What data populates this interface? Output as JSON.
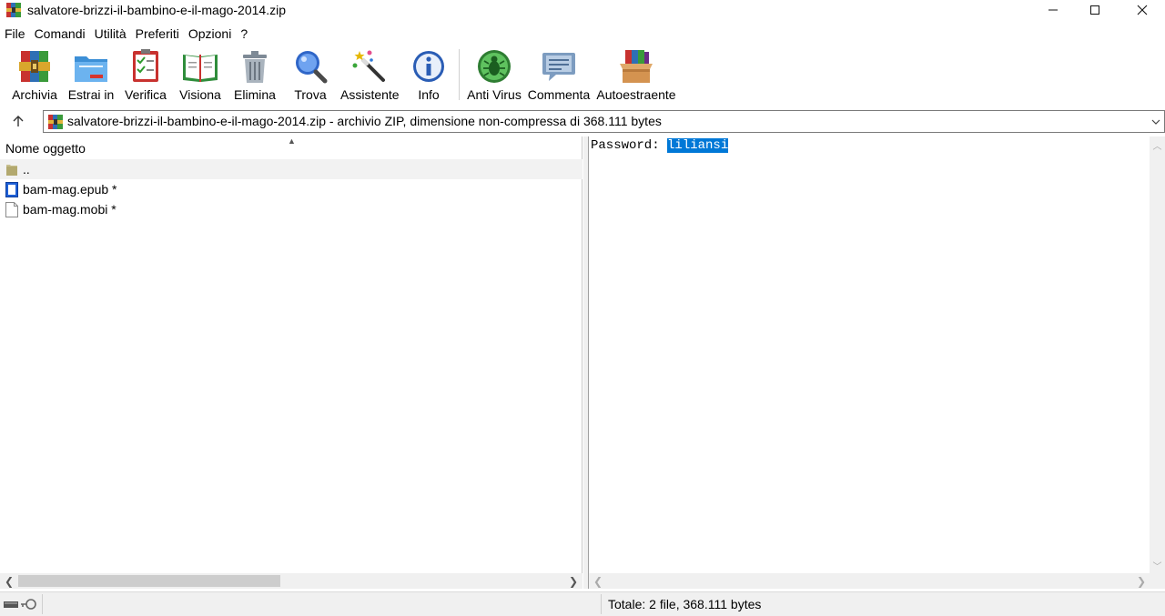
{
  "window": {
    "title": "salvatore-brizzi-il-bambino-e-il-mago-2014.zip"
  },
  "menu": {
    "items": [
      "File",
      "Comandi",
      "Utilità",
      "Preferiti",
      "Opzioni",
      "?"
    ]
  },
  "toolbar": {
    "buttons": [
      {
        "label": "Archivia",
        "icon": "archive-books-icon"
      },
      {
        "label": "Estrai in",
        "icon": "extract-folder-icon"
      },
      {
        "label": "Verifica",
        "icon": "test-checklist-icon"
      },
      {
        "label": "Visiona",
        "icon": "view-book-icon"
      },
      {
        "label": "Elimina",
        "icon": "trash-icon"
      },
      {
        "label": "Trova",
        "icon": "magnifier-icon"
      },
      {
        "label": "Assistente",
        "icon": "wizard-wand-icon"
      },
      {
        "label": "Info",
        "icon": "info-icon"
      },
      {
        "label": "Anti Virus",
        "icon": "antivirus-bug-icon"
      },
      {
        "label": "Commenta",
        "icon": "comment-bubble-icon"
      },
      {
        "label": "Autoestraente",
        "icon": "sfx-box-icon"
      }
    ]
  },
  "address": {
    "text": "salvatore-brizzi-il-bambino-e-il-mago-2014.zip - archivio ZIP, dimensione non-compressa di 368.111 bytes"
  },
  "file_list": {
    "column_header": "Nome oggetto",
    "rows": [
      {
        "name": "..",
        "icon": "folder-up-icon"
      },
      {
        "name": "bam-mag.epub *",
        "icon": "epub-file-icon"
      },
      {
        "name": "bam-mag.mobi *",
        "icon": "generic-file-icon"
      }
    ]
  },
  "comment": {
    "label": "Password: ",
    "selected": "liliansi"
  },
  "status": {
    "text": "Totale: 2 file, 368.111 bytes"
  },
  "colors": {
    "selection": "#0078d7",
    "pane_border": "#a0a0a0",
    "status_bg": "#f0f0f0"
  }
}
